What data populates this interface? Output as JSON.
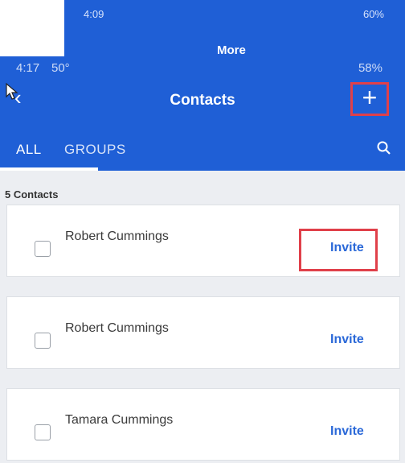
{
  "back_screen": {
    "time": "4:09",
    "status_right": "60%",
    "title": "More"
  },
  "status_bar": {
    "time": "4:17",
    "temp": "50°",
    "battery": "58%"
  },
  "header": {
    "title": "Contacts",
    "add_label": "+"
  },
  "tabs": [
    {
      "label": "ALL"
    },
    {
      "label": "GROUPS"
    }
  ],
  "contact_count": "5 Contacts",
  "contacts": [
    {
      "name": "Robert Cummings",
      "action": "Invite"
    },
    {
      "name": "Robert Cummings",
      "action": "Invite"
    },
    {
      "name": "Tamara Cummings",
      "action": "Invite"
    }
  ],
  "colors": {
    "header_bg": "#1f5fd6",
    "highlight": "#e0404a",
    "invite": "#2a68d8"
  }
}
